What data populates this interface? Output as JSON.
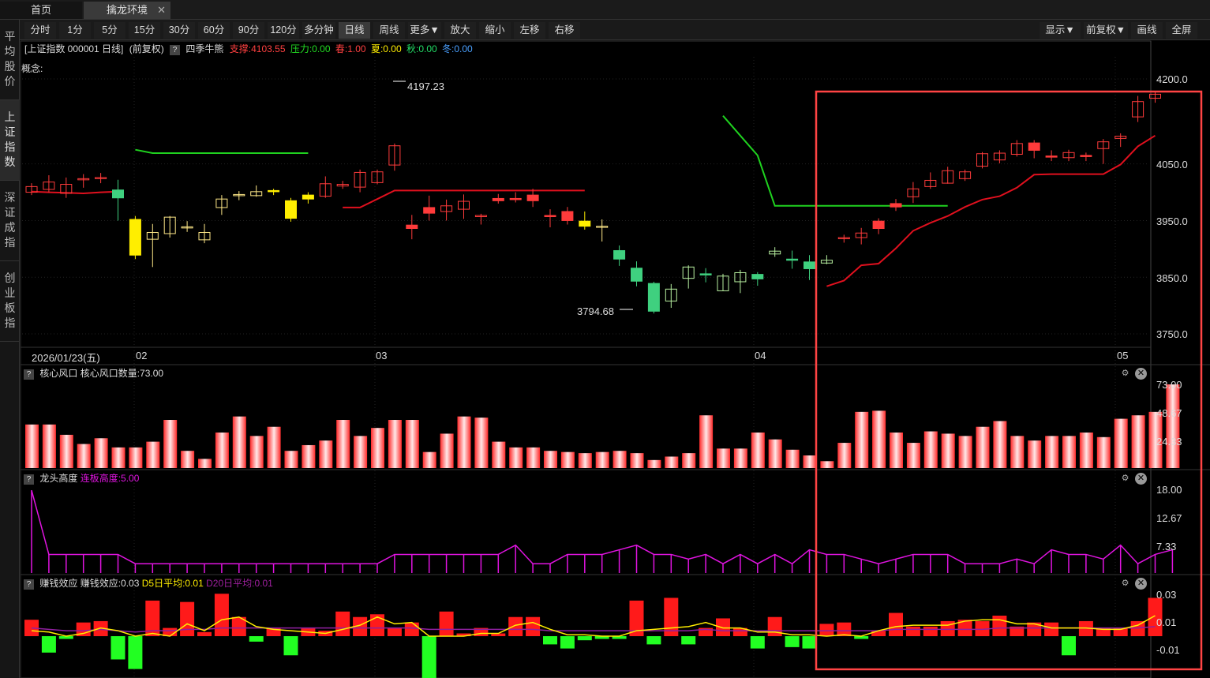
{
  "tabs": [
    {
      "label": "首页"
    },
    {
      "label": "擒龙环境",
      "close": "✕"
    }
  ],
  "sidebar": [
    {
      "label": "平均股价"
    },
    {
      "label": "上证指数"
    },
    {
      "label": "深证成指"
    },
    {
      "label": "创业板指"
    }
  ],
  "toolbar": {
    "periods": [
      "分时",
      "1分",
      "5分",
      "15分",
      "30分",
      "60分",
      "90分",
      "120分",
      "多分钟",
      "日线",
      "周线",
      "更多▼",
      "放大",
      "缩小",
      "左移",
      "右移"
    ],
    "selected": "日线",
    "right": [
      "显示▼",
      "前复权▼",
      "画线",
      "全屏"
    ]
  },
  "info": {
    "title": "[上证指数 000001 日线]",
    "adjust": "(前复权)",
    "help": "?",
    "indicator": "四季牛熊",
    "support": "支撑:4103.55",
    "pressure": "压力:0.00",
    "spring": "春:1.00",
    "summer": "夏:0.00",
    "autumn": "秋:0.00",
    "winter": "冬:0.00",
    "concept": "概念:"
  },
  "colors": {
    "up": "#ff3b3b",
    "down": "#3fd07f",
    "support": "#e0101e",
    "pressure": "#1fd21f",
    "yellow": "#ffee00",
    "magenta": "#e014e0",
    "highlight": "#ff4444"
  },
  "price_axis": [
    "4200.0",
    "4050.0",
    "3950.0",
    "3850.0",
    "3750.0"
  ],
  "price_ticks": [
    4200,
    4050,
    3950,
    3850,
    3750
  ],
  "markers": {
    "high": "4197.23",
    "low": "3794.68"
  },
  "dates": {
    "first": "2026/01/23(五)",
    "m2": "02",
    "m3": "03",
    "m4": "04",
    "m5": "05"
  },
  "panels": {
    "core": {
      "help": "?",
      "title": "核心风口",
      "value": "核心风口数量:73.00",
      "axis": [
        "73.00",
        "48.67",
        "24.33"
      ]
    },
    "dragon": {
      "help": "?",
      "title": "龙头高度",
      "value": "连板高度:5.00",
      "axis": [
        "18.00",
        "12.67",
        "7.33"
      ]
    },
    "money": {
      "help": "?",
      "title": "赚钱效应",
      "value": "赚钱效应:0.03",
      "d5": "D5日平均:0.01",
      "d20": "D20日平均:0.01",
      "axis": [
        "0.03",
        "0.01",
        "-0.01"
      ]
    }
  },
  "icons": {
    "gear": "⚙",
    "close": "✕"
  },
  "chart_data": {
    "type": "candlestick",
    "candles": [
      {
        "o": 4000,
        "c": 4010,
        "h": 4016,
        "l": 3995,
        "k": "up"
      },
      {
        "o": 4005,
        "c": 4018,
        "h": 4030,
        "l": 4000,
        "k": "up"
      },
      {
        "o": 3998,
        "c": 4014,
        "h": 4026,
        "l": 3990,
        "k": "up"
      },
      {
        "o": 4022,
        "c": 4024,
        "h": 4032,
        "l": 4008,
        "k": "up"
      },
      {
        "o": 4024,
        "c": 4026,
        "h": 4034,
        "l": 4016,
        "k": "up"
      },
      {
        "o": 4004,
        "c": 3990,
        "h": 4022,
        "l": 3950,
        "k": "down"
      },
      {
        "o": 3952,
        "c": 3889,
        "h": 3958,
        "l": 3882,
        "k": "yellow"
      },
      {
        "o": 3917,
        "c": 3929,
        "h": 3944,
        "l": 3868,
        "k": "hollow"
      },
      {
        "o": 3956,
        "c": 3927,
        "h": 3958,
        "l": 3920,
        "k": "hollow"
      },
      {
        "o": 3937,
        "c": 3939,
        "h": 3949,
        "l": 3930,
        "k": "hollow"
      },
      {
        "o": 3929,
        "c": 3916,
        "h": 3944,
        "l": 3910,
        "k": "hollow"
      },
      {
        "o": 3973,
        "c": 3988,
        "h": 3995,
        "l": 3960,
        "k": "hollow"
      },
      {
        "o": 3994,
        "c": 3996,
        "h": 4002,
        "l": 3986,
        "k": "hollow"
      },
      {
        "o": 3994,
        "c": 4001,
        "h": 4012,
        "l": 3992,
        "k": "hollow"
      },
      {
        "o": 4001,
        "c": 4003,
        "h": 4006,
        "l": 3995,
        "k": "yellow"
      },
      {
        "o": 3985,
        "c": 3954,
        "h": 3990,
        "l": 3948,
        "k": "yellow"
      },
      {
        "o": 3995,
        "c": 3988,
        "h": 4000,
        "l": 3980,
        "k": "yellow"
      },
      {
        "o": 3993,
        "c": 4015,
        "h": 4028,
        "l": 3990,
        "k": "up"
      },
      {
        "o": 4011,
        "c": 4014,
        "h": 4020,
        "l": 4006,
        "k": "up"
      },
      {
        "o": 4009,
        "c": 4035,
        "h": 4040,
        "l": 4000,
        "k": "up"
      },
      {
        "o": 4017,
        "c": 4036,
        "h": 4040,
        "l": 4014,
        "k": "up"
      },
      {
        "o": 4048,
        "c": 4082,
        "h": 4086,
        "l": 4038,
        "k": "up"
      },
      {
        "o": 3942,
        "c": 3936,
        "h": 3960,
        "l": 3917,
        "k": "up"
      },
      {
        "o": 3973,
        "c": 3963,
        "h": 3994,
        "l": 3950,
        "k": "up"
      },
      {
        "o": 3966,
        "c": 3976,
        "h": 3987,
        "l": 3950,
        "k": "up"
      },
      {
        "o": 3970,
        "c": 3984,
        "h": 3996,
        "l": 3953,
        "k": "up"
      },
      {
        "o": 3957,
        "c": 3959,
        "h": 3962,
        "l": 3943,
        "k": "up"
      },
      {
        "o": 3989,
        "c": 3985,
        "h": 3997,
        "l": 3980,
        "k": "up"
      },
      {
        "o": 3989,
        "c": 3988,
        "h": 4000,
        "l": 3982,
        "k": "up"
      },
      {
        "o": 3995,
        "c": 3985,
        "h": 4006,
        "l": 3974,
        "k": "up"
      },
      {
        "o": 3959,
        "c": 3959,
        "h": 3970,
        "l": 3938,
        "k": "up"
      },
      {
        "o": 3966,
        "c": 3950,
        "h": 3974,
        "l": 3943,
        "k": "up"
      },
      {
        "o": 3949,
        "c": 3940,
        "h": 3966,
        "l": 3934,
        "k": "yellow"
      },
      {
        "o": 3940,
        "c": 3938,
        "h": 3952,
        "l": 3913,
        "k": "hollow"
      },
      {
        "o": 3897,
        "c": 3882,
        "h": 3906,
        "l": 3870,
        "k": "down"
      },
      {
        "o": 3866,
        "c": 3843,
        "h": 3878,
        "l": 3834,
        "k": "down"
      },
      {
        "o": 3839,
        "c": 3790,
        "h": 3842,
        "l": 3786,
        "k": "down"
      },
      {
        "o": 3829,
        "c": 3808,
        "h": 3838,
        "l": 3796,
        "k": "hollow"
      },
      {
        "o": 3868,
        "c": 3848,
        "h": 3871,
        "l": 3830,
        "k": "hollow"
      },
      {
        "o": 3856,
        "c": 3856,
        "h": 3866,
        "l": 3841,
        "k": "down"
      },
      {
        "o": 3826,
        "c": 3852,
        "h": 3856,
        "l": 3826,
        "k": "hollow"
      },
      {
        "o": 3842,
        "c": 3858,
        "h": 3863,
        "l": 3822,
        "k": "hollow"
      },
      {
        "o": 3855,
        "c": 3847,
        "h": 3859,
        "l": 3835,
        "k": "down"
      },
      {
        "o": 3896,
        "c": 3891,
        "h": 3903,
        "l": 3886,
        "k": "hollow"
      },
      {
        "o": 3880,
        "c": 3882,
        "h": 3897,
        "l": 3865,
        "k": "down"
      },
      {
        "o": 3865,
        "c": 3877,
        "h": 3889,
        "l": 3845,
        "k": "down"
      },
      {
        "o": 3875,
        "c": 3880,
        "h": 3889,
        "l": 3873,
        "k": "hollow"
      },
      {
        "o": 3919,
        "c": 3920,
        "h": 3925,
        "l": 3911,
        "k": "up"
      },
      {
        "o": 3920,
        "c": 3928,
        "h": 3937,
        "l": 3908,
        "k": "up"
      },
      {
        "o": 3949,
        "c": 3936,
        "h": 3954,
        "l": 3926,
        "k": "up"
      },
      {
        "o": 3980,
        "c": 3974,
        "h": 3988,
        "l": 3967,
        "k": "up"
      },
      {
        "o": 3992,
        "c": 4006,
        "h": 4018,
        "l": 3981,
        "k": "up"
      },
      {
        "o": 4010,
        "c": 4021,
        "h": 4035,
        "l": 4006,
        "k": "up"
      },
      {
        "o": 4016,
        "c": 4038,
        "h": 4045,
        "l": 4015,
        "k": "up"
      },
      {
        "o": 4024,
        "c": 4036,
        "h": 4040,
        "l": 4020,
        "k": "up"
      },
      {
        "o": 4046,
        "c": 4068,
        "h": 4071,
        "l": 4042,
        "k": "up"
      },
      {
        "o": 4057,
        "c": 4069,
        "h": 4074,
        "l": 4051,
        "k": "up"
      },
      {
        "o": 4067,
        "c": 4086,
        "h": 4092,
        "l": 4063,
        "k": "up"
      },
      {
        "o": 4087,
        "c": 4074,
        "h": 4092,
        "l": 4060,
        "k": "up"
      },
      {
        "o": 4064,
        "c": 4062,
        "h": 4074,
        "l": 4055,
        "k": "up"
      },
      {
        "o": 4061,
        "c": 4070,
        "h": 4075,
        "l": 4055,
        "k": "up"
      },
      {
        "o": 4065,
        "c": 4065,
        "h": 4070,
        "l": 4055,
        "k": "up"
      },
      {
        "o": 4077,
        "c": 4089,
        "h": 4094,
        "l": 4050,
        "k": "up"
      },
      {
        "o": 4095,
        "c": 4099,
        "h": 4104,
        "l": 4080,
        "k": "up"
      },
      {
        "o": 4133,
        "c": 4160,
        "h": 4170,
        "l": 4124,
        "k": "up"
      },
      {
        "o": 4166,
        "c": 4173,
        "h": 4178,
        "l": 4158,
        "k": "up"
      }
    ],
    "support_line": [
      [
        0,
        4001
      ],
      [
        1,
        4000
      ],
      [
        2,
        3999
      ],
      [
        3,
        3998
      ],
      [
        4,
        4000
      ],
      [
        5,
        4001
      ],
      [
        6,
        null
      ],
      [
        7,
        null
      ],
      [
        8,
        null
      ],
      [
        9,
        null
      ],
      [
        10,
        null
      ],
      [
        11,
        null
      ],
      [
        12,
        null
      ],
      [
        13,
        null
      ],
      [
        14,
        null
      ],
      [
        15,
        null
      ],
      [
        16,
        null
      ],
      [
        17,
        null
      ],
      [
        18,
        3973
      ],
      [
        19,
        3973
      ],
      [
        20,
        3988
      ],
      [
        21,
        4003
      ],
      [
        22,
        4003
      ],
      [
        23,
        4003
      ],
      [
        24,
        4003
      ],
      [
        25,
        4003
      ],
      [
        26,
        4003
      ],
      [
        27,
        4003
      ],
      [
        28,
        4003
      ],
      [
        29,
        4003
      ],
      [
        30,
        4003
      ],
      [
        31,
        4003
      ],
      [
        32,
        4003
      ],
      [
        33,
        null
      ],
      [
        34,
        null
      ],
      [
        35,
        null
      ],
      [
        36,
        null
      ],
      [
        37,
        null
      ],
      [
        38,
        null
      ],
      [
        39,
        null
      ],
      [
        40,
        null
      ],
      [
        41,
        null
      ],
      [
        42,
        null
      ],
      [
        43,
        null
      ],
      [
        44,
        null
      ],
      [
        45,
        null
      ],
      [
        46,
        3834
      ],
      [
        47,
        3844
      ],
      [
        48,
        3871
      ],
      [
        49,
        3874
      ],
      [
        50,
        3901
      ],
      [
        51,
        3932
      ],
      [
        52,
        3946
      ],
      [
        53,
        3958
      ],
      [
        54,
        3974
      ],
      [
        55,
        3987
      ],
      [
        56,
        3993
      ],
      [
        57,
        4008
      ],
      [
        58,
        4031
      ],
      [
        59,
        4032
      ],
      [
        60,
        4032
      ],
      [
        61,
        4032
      ],
      [
        62,
        4032
      ],
      [
        63,
        4049
      ],
      [
        64,
        4081
      ],
      [
        65,
        4100
      ]
    ],
    "pressure_line": [
      [
        6,
        4075
      ],
      [
        7,
        4069
      ],
      [
        8,
        4069
      ],
      [
        9,
        4069
      ],
      [
        10,
        4069
      ],
      [
        11,
        4069
      ],
      [
        12,
        4069
      ],
      [
        13,
        4069
      ],
      [
        14,
        4069
      ],
      [
        15,
        4069
      ],
      [
        16,
        4069
      ],
      [
        40,
        4135
      ],
      [
        41,
        4100
      ],
      [
        42,
        4065
      ],
      [
        43,
        3976
      ],
      [
        44,
        3976
      ],
      [
        45,
        3976
      ],
      [
        46,
        3976
      ],
      [
        47,
        3976
      ],
      [
        48,
        3976
      ],
      [
        49,
        3976
      ],
      [
        50,
        3976
      ],
      [
        51,
        3976
      ],
      [
        52,
        3976
      ],
      [
        53,
        3976
      ]
    ],
    "core_counts": [
      38,
      38,
      29,
      21,
      26,
      18,
      18,
      23,
      42,
      15,
      8,
      31,
      45,
      28,
      36,
      15,
      20,
      24,
      42,
      28,
      35,
      42,
      42,
      14,
      30,
      45,
      44,
      23,
      18,
      18,
      15,
      14,
      13,
      14,
      15,
      13,
      7,
      10,
      13,
      46,
      17,
      17,
      31,
      25,
      16,
      11,
      6,
      22,
      49,
      50,
      31,
      22,
      32,
      30,
      28,
      36,
      41,
      28,
      24,
      28,
      28,
      31,
      27,
      43,
      46,
      49,
      73
    ],
    "dragon_heights": [
      17.8,
      4,
      4,
      4,
      4,
      4,
      2,
      2,
      2,
      2,
      2,
      2,
      2,
      2,
      2,
      2,
      2,
      2,
      2,
      2,
      2,
      4,
      4,
      4,
      4,
      4,
      4,
      4,
      6,
      2,
      2,
      4,
      4,
      4,
      5,
      6,
      4,
      4,
      3,
      4,
      2,
      4,
      2,
      4,
      2,
      5,
      4,
      4,
      3,
      2,
      3,
      4,
      4,
      4,
      2,
      2,
      2,
      3,
      2,
      5,
      4,
      4,
      3,
      6,
      2,
      4,
      5
    ],
    "money_bars": [
      0.012,
      -0.012,
      -0.002,
      0.01,
      0.011,
      -0.017,
      -0.024,
      0.026,
      0.006,
      0.025,
      0.003,
      0.031,
      0.014,
      -0.004,
      0.006,
      -0.014,
      0.006,
      0.004,
      0.018,
      0.014,
      0.016,
      0.006,
      0.01,
      -0.036,
      0.018,
      0.002,
      0.006,
      0.002,
      0.014,
      0.014,
      -0.006,
      -0.009,
      -0.003,
      -0.002,
      -0.002,
      0.026,
      -0.006,
      0.028,
      -0.006,
      0.006,
      0.013,
      0.006,
      -0.009,
      0.014,
      -0.008,
      -0.009,
      0.009,
      0.01,
      -0.002,
      0.004,
      0.017,
      0.007,
      0.007,
      0.011,
      0.012,
      0.011,
      0.015,
      0.007,
      0.01,
      0.01,
      -0.014,
      0.011,
      0.006,
      0.006,
      0.011,
      0.028
    ],
    "d5": [
      0.004,
      0.003,
      0.0,
      0.002,
      0.006,
      0.004,
      0.0,
      0.002,
      0.0,
      0.009,
      0.004,
      0.012,
      0.014,
      0.007,
      0.005,
      0.004,
      0.003,
      0.002,
      0.005,
      0.008,
      0.014,
      0.009,
      0.01,
      0.0,
      0.0,
      0.0,
      0.002,
      0.002,
      0.008,
      0.01,
      0.005,
      0.001,
      0.001,
      0.0,
      0.0,
      0.004,
      0.005,
      0.006,
      0.007,
      0.01,
      0.006,
      0.006,
      0.003,
      0.003,
      0.001,
      0.001,
      0.0,
      0.001,
      0.0,
      0.004,
      0.007,
      0.008,
      0.008,
      0.008,
      0.011,
      0.012,
      0.012,
      0.009,
      0.009,
      0.006,
      0.006,
      0.006,
      0.005,
      0.005,
      0.008,
      0.015
    ],
    "d20": [
      0.006,
      0.005,
      0.004,
      0.004,
      0.005,
      0.004,
      0.003,
      0.004,
      0.004,
      0.005,
      0.005,
      0.006,
      0.006,
      0.006,
      0.006,
      0.006,
      0.006,
      0.006,
      0.006,
      0.006,
      0.006,
      0.006,
      0.006,
      0.005,
      0.005,
      0.005,
      0.005,
      0.005,
      0.005,
      0.005,
      0.004,
      0.004,
      0.004,
      0.004,
      0.004,
      0.004,
      0.004,
      0.004,
      0.004,
      0.005,
      0.004,
      0.004,
      0.004,
      0.004,
      0.004,
      0.004,
      0.004,
      0.004,
      0.004,
      0.004,
      0.005,
      0.005,
      0.005,
      0.005,
      0.005,
      0.005,
      0.006,
      0.006,
      0.006,
      0.006,
      0.006,
      0.006,
      0.006,
      0.006,
      0.006,
      0.007
    ]
  }
}
